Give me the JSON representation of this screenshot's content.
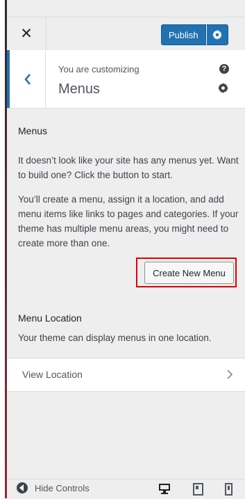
{
  "header": {
    "close_glyph": "✕",
    "publish_label": "Publish"
  },
  "info": {
    "customizing_label": "You are customizing",
    "section_title": "Menus"
  },
  "menus_section": {
    "heading": "Menus",
    "paragraph1": "It doesn’t look like your site has any menus yet. Want to build one? Click the button to start.",
    "paragraph2": "You’ll create a menu, assign it a location, and add menu items like links to pages and categories. If your theme has multiple menu areas, you might need to create more than one.",
    "create_button_label": "Create New Menu"
  },
  "menu_location": {
    "heading": "Menu Location",
    "description": "Your theme can display menus in one location.",
    "view_location_label": "View Location"
  },
  "footer": {
    "hide_controls_label": "Hide Controls"
  },
  "colors": {
    "accent": "#2271b1",
    "highlight": "#e00000"
  }
}
